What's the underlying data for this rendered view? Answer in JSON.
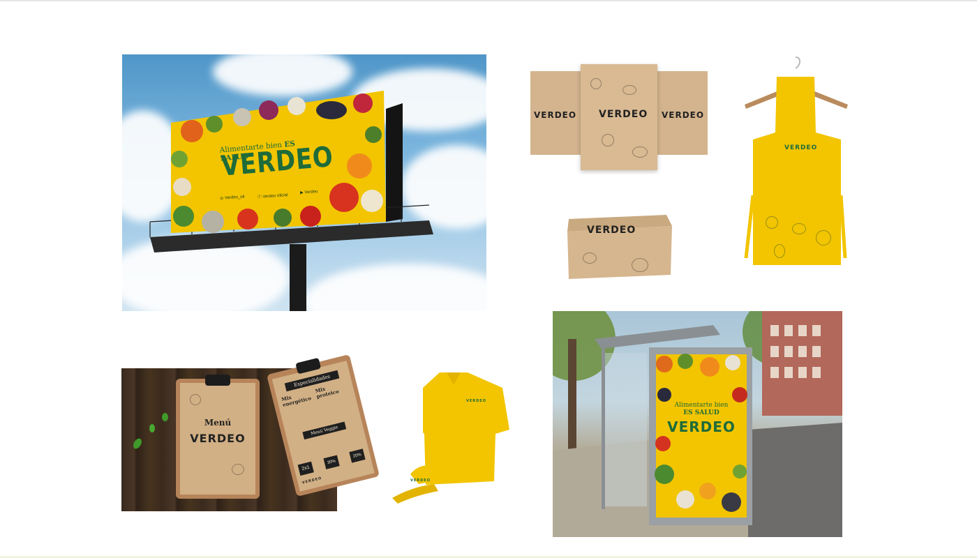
{
  "brand": {
    "name": "VERDEO",
    "primary_color": "#f2c500",
    "green_color": "#1f6b3a",
    "kraft_color": "#d4b48e"
  },
  "billboard": {
    "tagline_prefix": "Alimentarte bien",
    "tagline_emphasis": "ES SALUD",
    "wordmark": "VERDEO",
    "socials": [
      {
        "icon": "instagram-icon",
        "label": "Verdeo_ok"
      },
      {
        "icon": "facebook-icon",
        "label": "Verdeo oficial"
      },
      {
        "icon": "youtube-icon",
        "label": "Verdeo"
      }
    ]
  },
  "bags": {
    "wordmarks": [
      "VERDEO",
      "VERDEO",
      "VERDEO"
    ]
  },
  "box": {
    "wordmark": "VERDEO"
  },
  "apron": {
    "wordmark": "VERDEO"
  },
  "menu": {
    "left_card": {
      "title": "Menú",
      "wordmark": "VERDEO"
    },
    "right_card": {
      "heading": "Especialidades",
      "item_a": "Mix energético",
      "item_b": "Mix proteico",
      "subheading": "Menú Veggie",
      "promo_a": "2x1",
      "promo_b": "30%",
      "promo_c": "20%",
      "footer_wordmark": "VERDEO"
    }
  },
  "apparel": {
    "polo_wordmark": "VERDEO",
    "cap_wordmark": "VERDEO"
  },
  "busstop": {
    "tagline_prefix": "Alimentarte bien",
    "tagline_emphasis": "ES SALUD",
    "wordmark": "VERDEO"
  }
}
